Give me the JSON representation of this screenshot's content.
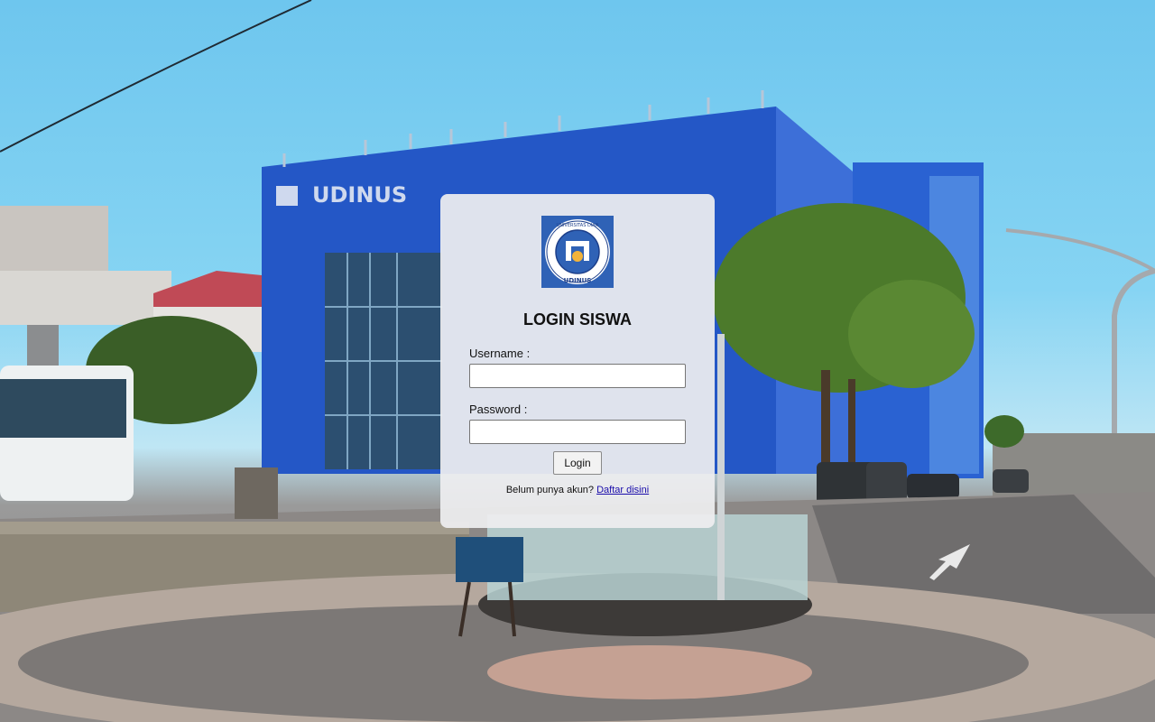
{
  "background": {
    "building_sign": "UDINUS",
    "sky_color": "#78cdf0",
    "building_color": "#2457c6"
  },
  "login_card": {
    "logo": {
      "ring_text": "UNIVERSITAS DIAN NUSWANTORO",
      "bottom_text": "UDINUS",
      "bg_color": "#2f62b6",
      "accent_color": "#f2b33a"
    },
    "title": "LOGIN SISWA",
    "username_label": "Username :",
    "username_value": "",
    "password_label": "Password :",
    "password_value": "",
    "login_button": "Login",
    "register_prompt": "Belum punya akun?",
    "register_link": "Daftar disini"
  }
}
